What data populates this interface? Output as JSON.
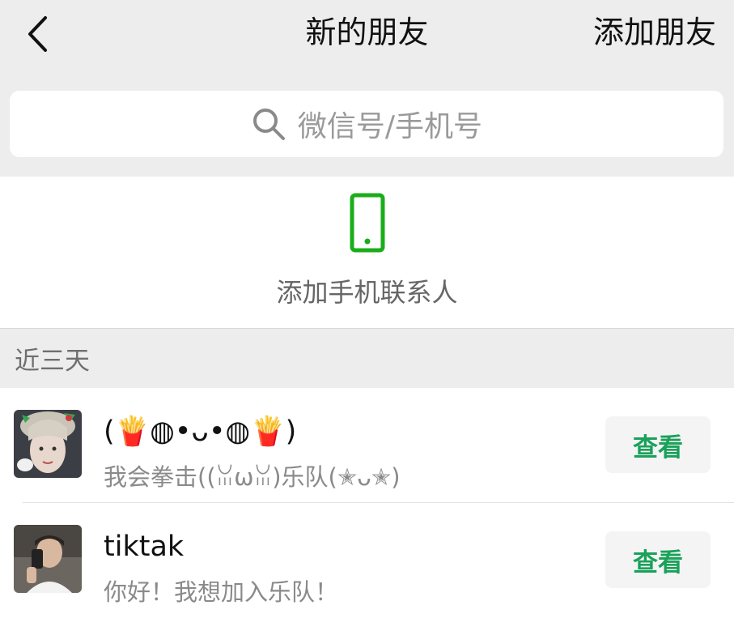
{
  "header": {
    "back_icon": "chevron-left-icon",
    "title": "新的朋友",
    "right_action": "添加朋友"
  },
  "search": {
    "icon": "search-icon",
    "placeholder": "微信号/手机号"
  },
  "phone_contacts": {
    "icon": "mobile-phone-icon",
    "label": "添加手机联系人",
    "icon_color": "#1aad19"
  },
  "section": {
    "label": "近三天"
  },
  "friends": [
    {
      "name": "(🍟◍•ᴗ•◍🍟)",
      "message": "我会拳击((ꈍωꈍ)乐队(✭ᴗ✭)",
      "button_label": "查看"
    },
    {
      "name": "tiktak",
      "message": "你好！我想加入乐队！",
      "button_label": "查看"
    }
  ],
  "colors": {
    "accent_green": "#1aa15a",
    "background": "#ededed"
  }
}
